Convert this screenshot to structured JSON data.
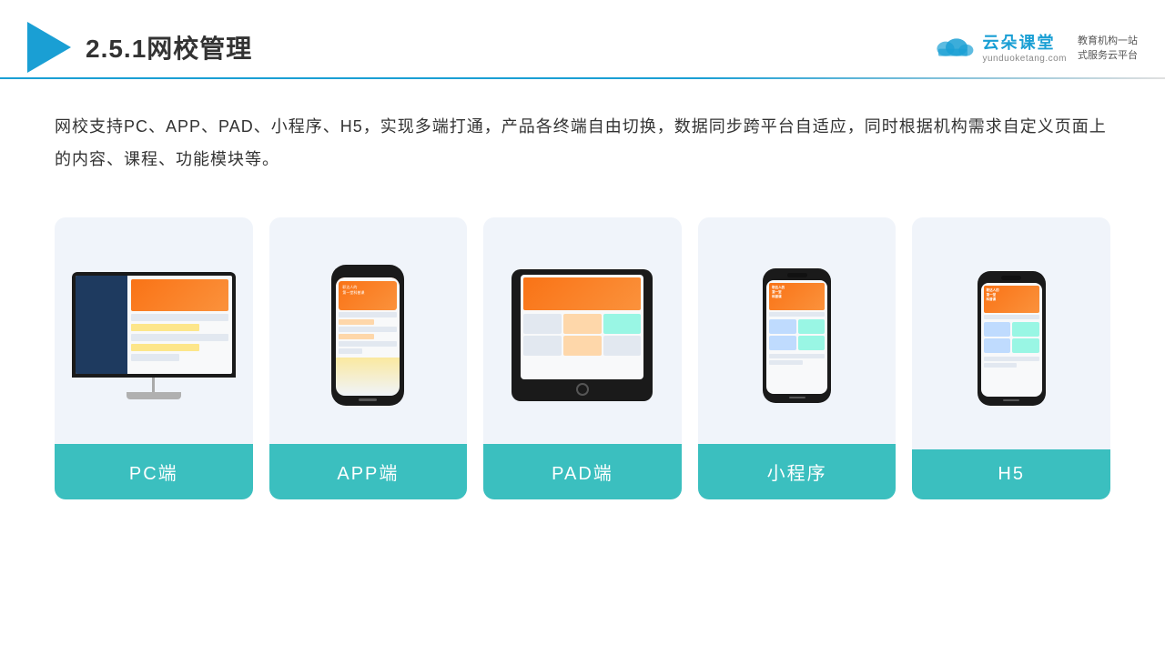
{
  "header": {
    "title": "2.5.1网校管理",
    "divider_color": "#1a9fd4"
  },
  "brand": {
    "name": "云朵课堂",
    "url": "yunduoketang.com",
    "slogan_line1": "教育机构一站",
    "slogan_line2": "式服务云平台"
  },
  "description": {
    "text": "网校支持PC、APP、PAD、小程序、H5，实现多端打通，产品各终端自由切换，数据同步跨平台自适应，同时根据机构需求自定义页面上的内容、课程、功能模块等。"
  },
  "cards": [
    {
      "id": "pc",
      "label": "PC端"
    },
    {
      "id": "app",
      "label": "APP端"
    },
    {
      "id": "pad",
      "label": "PAD端"
    },
    {
      "id": "miniprogram",
      "label": "小程序"
    },
    {
      "id": "h5",
      "label": "H5"
    }
  ]
}
